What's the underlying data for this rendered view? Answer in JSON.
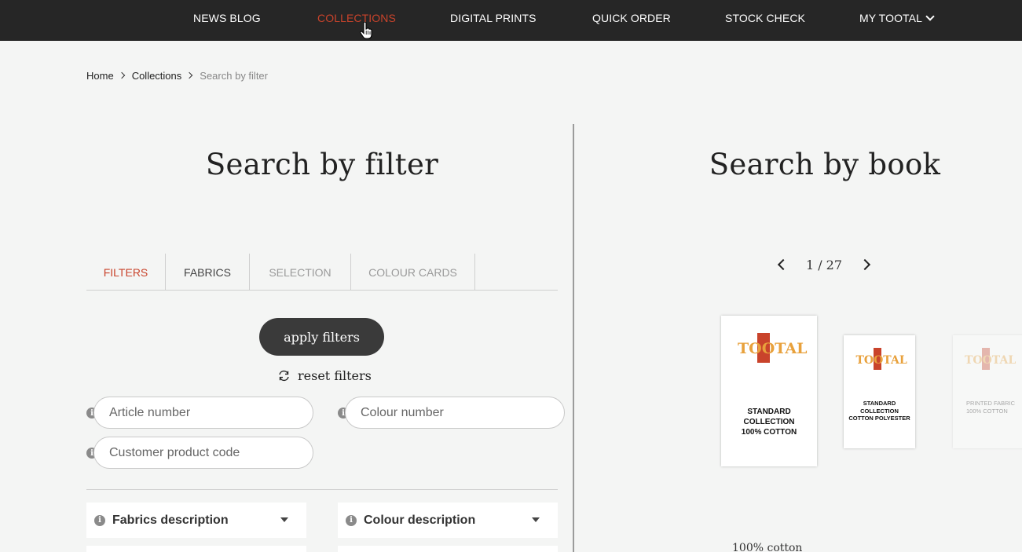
{
  "nav": {
    "items": [
      {
        "label": "NEWS BLOG"
      },
      {
        "label": "COLLECTIONS"
      },
      {
        "label": "DIGITAL PRINTS"
      },
      {
        "label": "QUICK ORDER"
      },
      {
        "label": "STOCK CHECK"
      },
      {
        "label": "MY TOOTAL"
      }
    ],
    "active_color": "#c9432b"
  },
  "breadcrumb": {
    "home": "Home",
    "collections": "Collections",
    "current": "Search by filter"
  },
  "filter_panel": {
    "title": "Search by filter",
    "tabs": [
      {
        "label": "FILTERS"
      },
      {
        "label": "FABRICS"
      },
      {
        "label": "SELECTION"
      },
      {
        "label": "COLOUR CARDS"
      }
    ],
    "apply_label": "apply filters",
    "reset_label": "reset filters",
    "inputs": {
      "article_placeholder": "Article number",
      "colour_placeholder": "Colour number",
      "customer_code_placeholder": "Customer product code"
    },
    "selects": {
      "fabrics_label": "Fabrics description",
      "colour_label": "Colour description"
    }
  },
  "book_panel": {
    "title": "Search by book",
    "pager": "1 / 27",
    "books": [
      {
        "brand": "TOOTAL",
        "caption": "STANDARD\nCOLLECTION\n100% COTTON"
      },
      {
        "brand": "TOOTAL",
        "caption": "STANDARD\nCOLLECTION\nCOTTON POLYESTER"
      },
      {
        "brand": "TOOTAL",
        "caption": "PRINTED FABRIC\n100% COTTON"
      }
    ],
    "selected_caption": "100% cotton"
  },
  "icons": [
    "chevron-down-icon",
    "chevron-right-icon",
    "refresh-icon",
    "info-icon",
    "chevron-left-icon",
    "hand-cursor-icon"
  ]
}
